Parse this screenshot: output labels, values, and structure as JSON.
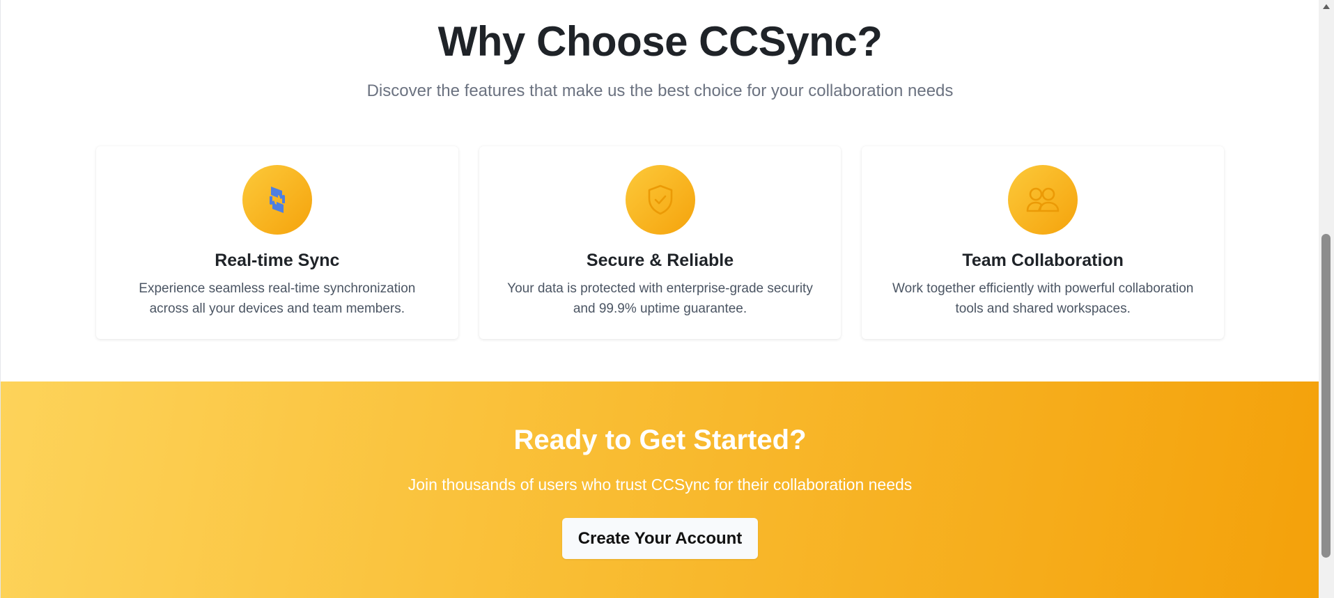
{
  "features": {
    "title": "Why Choose CCSync?",
    "subtitle": "Discover the features that make us the best choice for your collaboration needs",
    "cards": [
      {
        "icon": "sync-icon",
        "title": "Real-time Sync",
        "description": "Experience seamless real-time synchronization across all your devices and team members."
      },
      {
        "icon": "shield-check-icon",
        "title": "Secure & Reliable",
        "description": "Your data is protected with enterprise-grade security and 99.9% uptime guarantee."
      },
      {
        "icon": "users-icon",
        "title": "Team Collaboration",
        "description": "Work together efficiently with powerful collaboration tools and shared workspaces."
      }
    ]
  },
  "cta": {
    "title": "Ready to Get Started?",
    "subtitle": "Join thousands of users who trust CCSync for their collaboration needs",
    "button_label": "Create Your Account"
  },
  "colors": {
    "accent_start": "#fcc93a",
    "accent_end": "#f5a30c",
    "sync_icon": "#4f7fe0",
    "heading": "#1f2328",
    "muted": "#6b7280"
  }
}
